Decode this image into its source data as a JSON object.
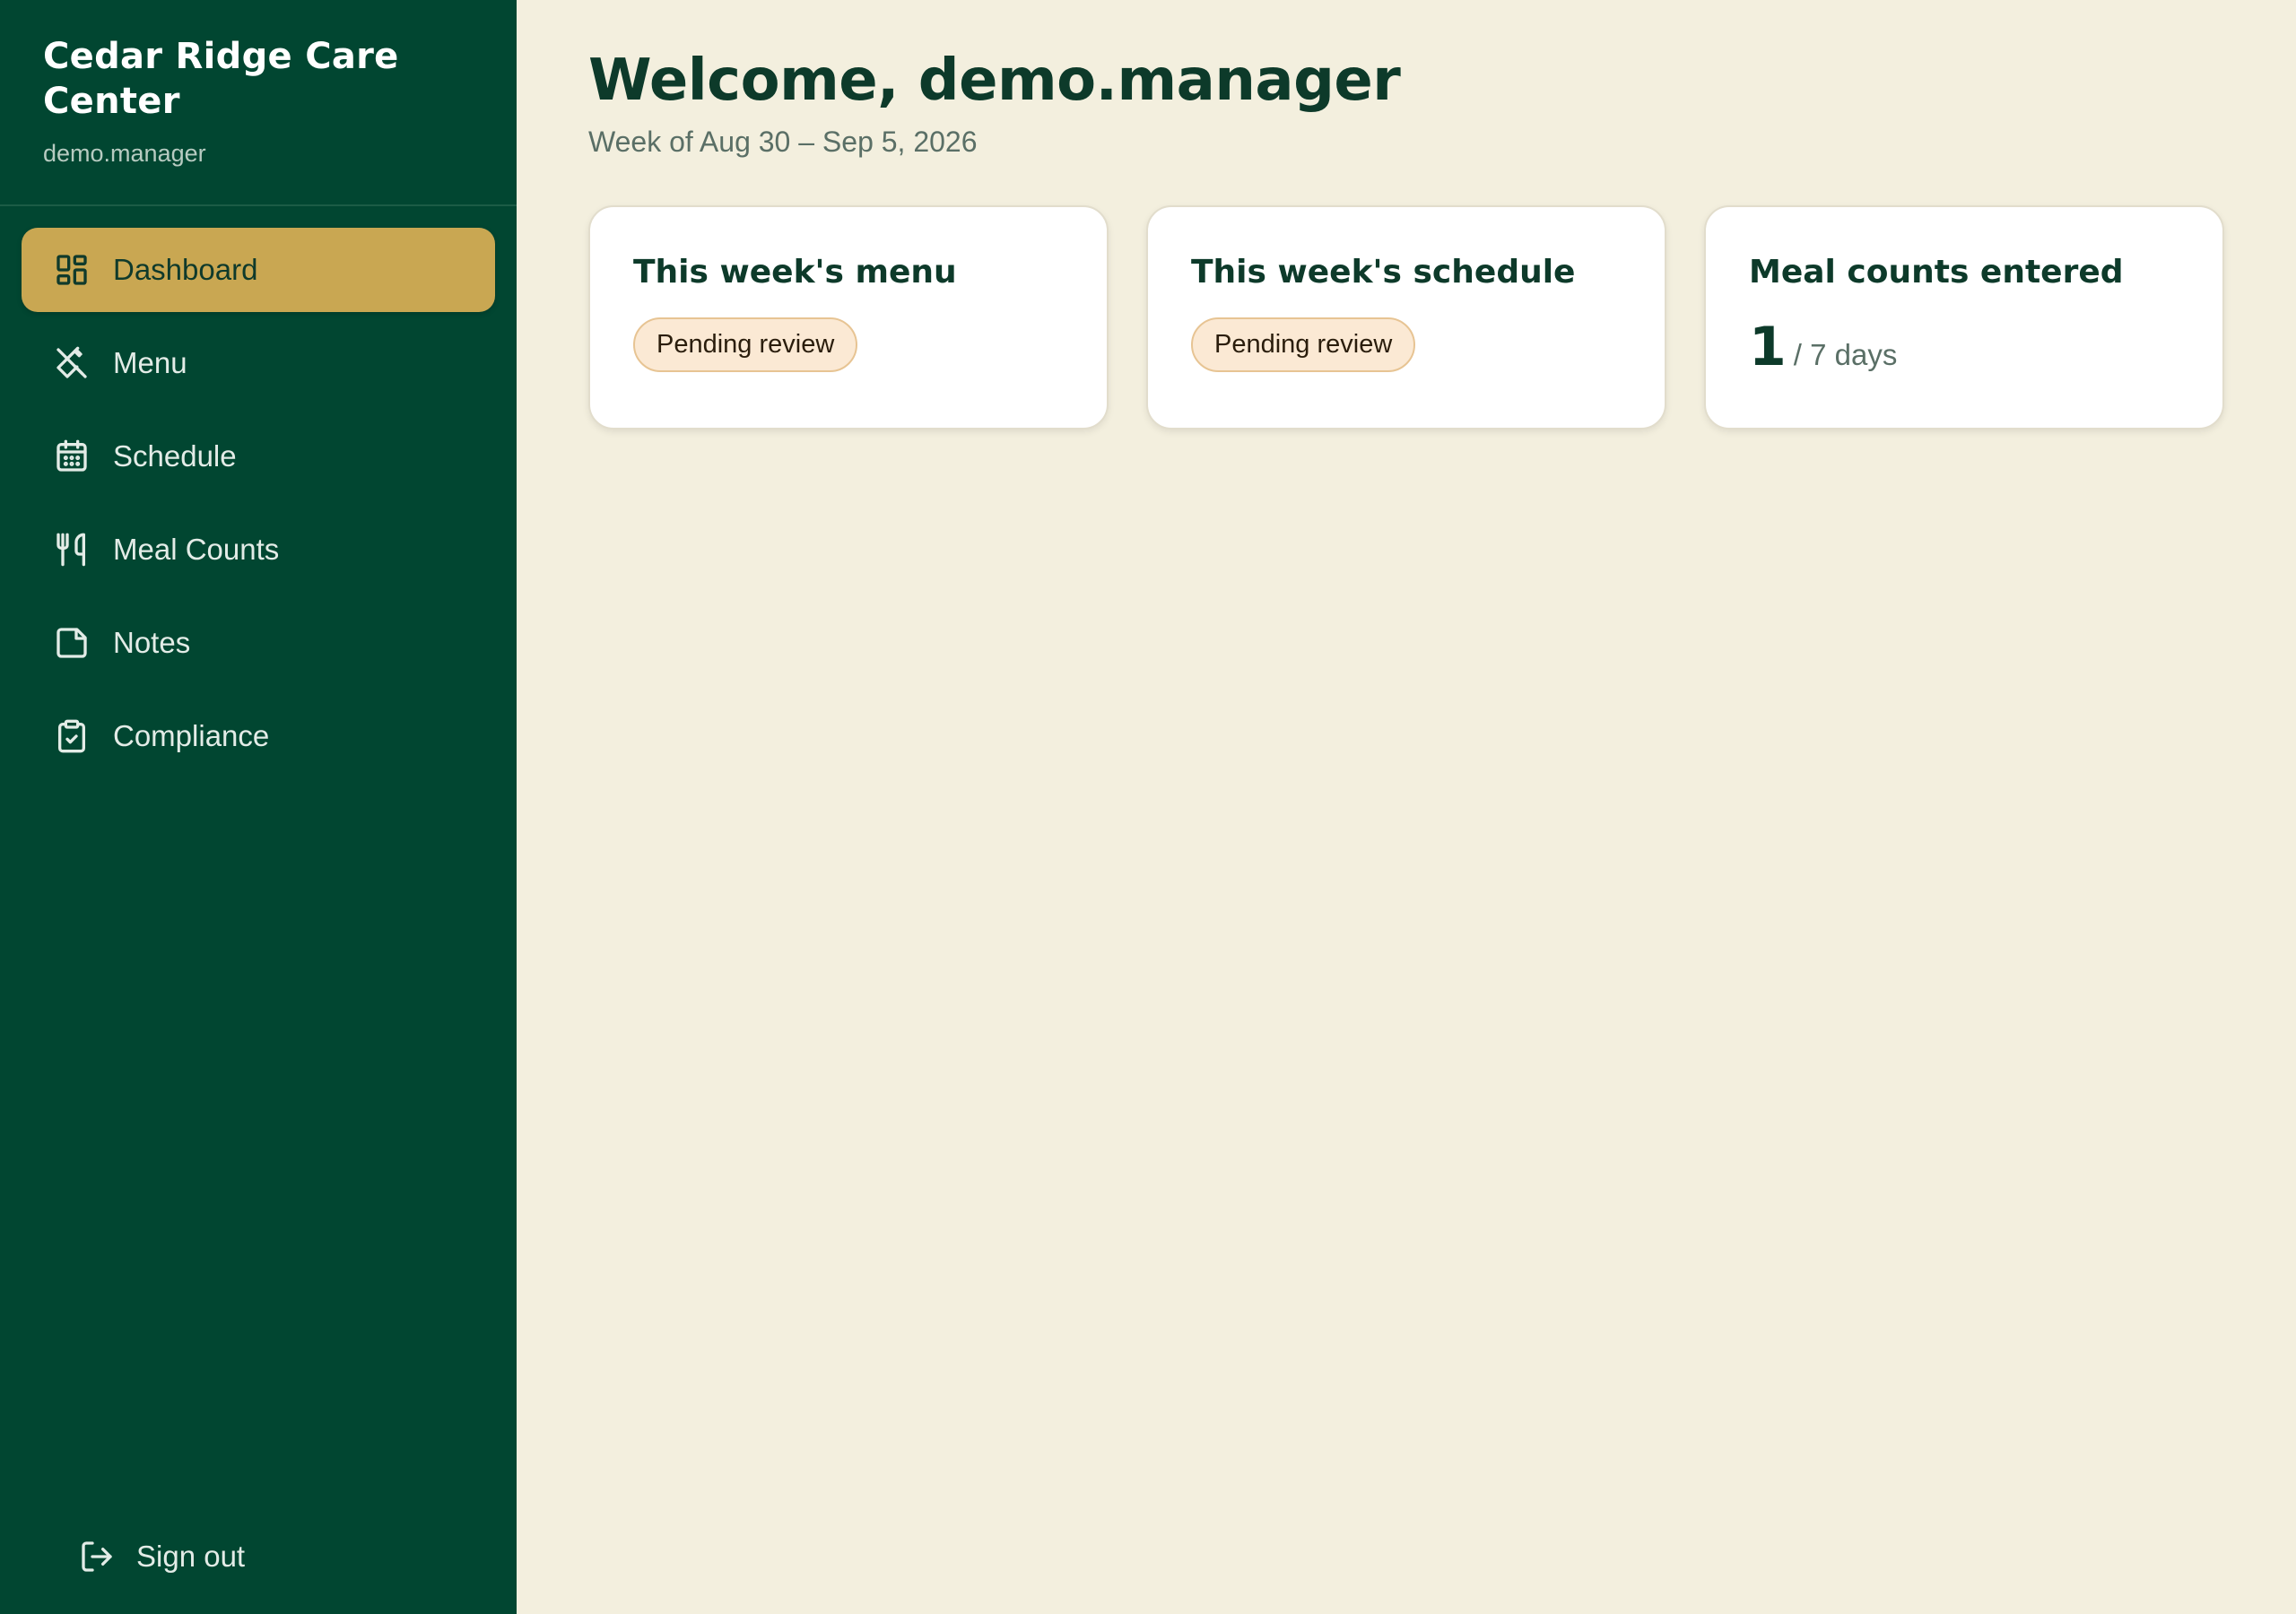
{
  "sidebar": {
    "brand_title": "Cedar Ridge Care Center",
    "brand_user": "demo.manager",
    "items": [
      {
        "label": "Dashboard",
        "icon": "dashboard-icon",
        "active": true
      },
      {
        "label": "Menu",
        "icon": "utensils-crossed-icon",
        "active": false
      },
      {
        "label": "Schedule",
        "icon": "calendar-icon",
        "active": false
      },
      {
        "label": "Meal Counts",
        "icon": "utensils-icon",
        "active": false
      },
      {
        "label": "Notes",
        "icon": "sticky-note-icon",
        "active": false
      },
      {
        "label": "Compliance",
        "icon": "clipboard-check-icon",
        "active": false
      }
    ],
    "signout_label": "Sign out",
    "signout_icon": "log-out-icon"
  },
  "main": {
    "title": "Welcome, demo.manager",
    "subtitle": "Week of Aug 30 – Sep 5, 2026",
    "cards": [
      {
        "title": "This week's menu",
        "badge": "Pending review"
      },
      {
        "title": "This week's schedule",
        "badge": "Pending review"
      },
      {
        "title": "Meal counts entered",
        "count": "1",
        "count_suffix": "/ 7 days"
      }
    ]
  },
  "colors": {
    "sidebar_bg": "#014631",
    "active_item_bg": "#c9a752",
    "page_bg": "#f3efde",
    "heading": "#0d3a2a",
    "badge_bg": "#fbe9d4",
    "badge_border": "#e7c493"
  }
}
